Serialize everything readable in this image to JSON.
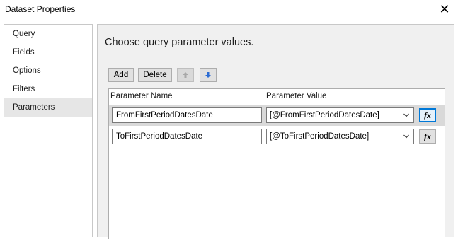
{
  "window": {
    "title": "Dataset Properties",
    "close_glyph": "✕"
  },
  "sidebar": {
    "items": [
      {
        "label": "Query"
      },
      {
        "label": "Fields"
      },
      {
        "label": "Options"
      },
      {
        "label": "Filters"
      },
      {
        "label": "Parameters",
        "active": true
      }
    ]
  },
  "main": {
    "heading": "Choose query parameter values.",
    "toolbar": {
      "add_label": "Add",
      "delete_label": "Delete",
      "move_up_icon": "arrow-up-icon",
      "move_down_icon": "arrow-down-icon"
    },
    "grid": {
      "columns": [
        "Parameter Name",
        "Parameter Value"
      ],
      "rows": [
        {
          "name": "FromFirstPeriodDatesDate",
          "value": "[@FromFirstPeriodDatesDate]",
          "fx": "fx",
          "selected": true
        },
        {
          "name": "ToFirstPeriodDatesDate",
          "value": "[@ToFirstPeriodDatesDate]",
          "fx": "fx",
          "selected": false
        }
      ]
    }
  },
  "colors": {
    "accent": "#0078d7",
    "selected_row": "#d9d9d9",
    "panel_bg": "#f0f0f0"
  }
}
